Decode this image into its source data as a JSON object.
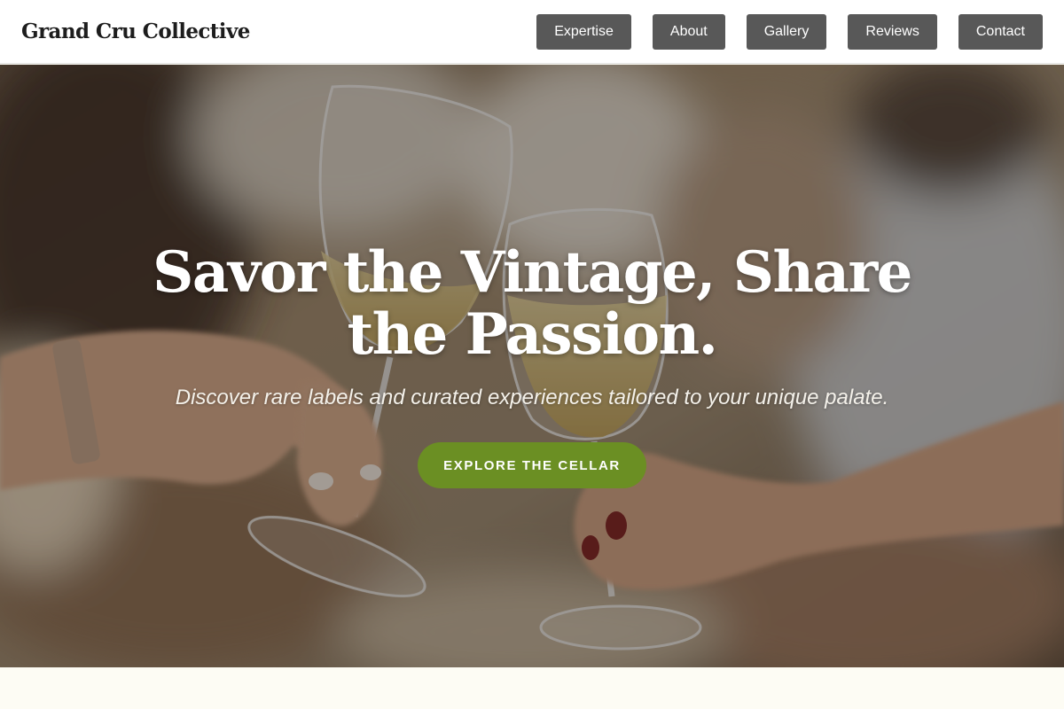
{
  "brand": {
    "name": "Grand Cru Collective"
  },
  "nav": {
    "items": [
      {
        "label": "Expertise"
      },
      {
        "label": "About"
      },
      {
        "label": "Gallery"
      },
      {
        "label": "Reviews"
      },
      {
        "label": "Contact"
      }
    ]
  },
  "hero": {
    "title": "Savor the Vintage, Share the Passion.",
    "subtitle": "Discover rare labels and curated experiences tailored to your unique palate.",
    "cta_label": "EXPLORE THE CELLAR",
    "image_subject": "hands toasting with glasses of white wine"
  },
  "colors": {
    "nav_button_bg": "#585858",
    "cta_bg": "#6b8f23",
    "header_bg": "#ffffff",
    "page_bg": "#fdfcf4"
  }
}
